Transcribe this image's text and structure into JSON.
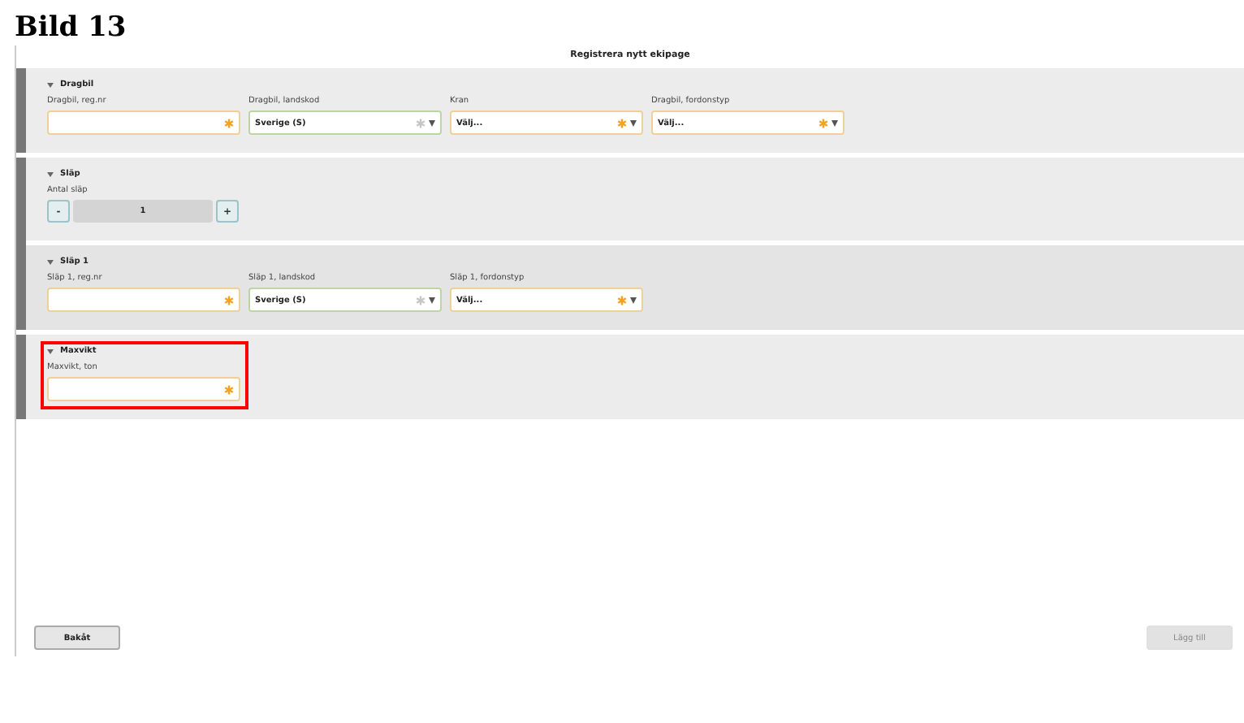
{
  "heading": "Bild 13",
  "window": {
    "title": "Registrera nytt ekipage"
  },
  "sections": [
    {
      "title": "Dragbil",
      "expanded": true,
      "highlighted": false,
      "fields": [
        {
          "kind": "text",
          "label": "Dragbil, reg.nr",
          "valid": false
        },
        {
          "kind": "select",
          "label": "Dragbil, landskod",
          "value": "Sverige (S)",
          "valid": true
        },
        {
          "kind": "select",
          "label": "Kran",
          "value": "Välj...",
          "valid": false
        },
        {
          "kind": "select",
          "label": "Dragbil, fordonstyp",
          "value": "Välj...",
          "valid": false
        }
      ]
    },
    {
      "title": "Släp",
      "expanded": true,
      "highlighted": false,
      "stepper": {
        "label": "Antal släp",
        "minus": "-",
        "value": "1",
        "plus": "+"
      },
      "children": [
        {
          "title": "Släp 1",
          "expanded": true,
          "highlighted": false,
          "fields": [
            {
              "kind": "text",
              "label": "Släp 1, reg.nr",
              "valid": false
            },
            {
              "kind": "select",
              "label": "Släp 1, landskod",
              "value": "Sverige (S)",
              "valid": true
            },
            {
              "kind": "select",
              "label": "Släp 1, fordonstyp",
              "value": "Välj...",
              "valid": false
            }
          ]
        }
      ]
    },
    {
      "title": "Maxvikt",
      "expanded": true,
      "highlighted": true,
      "fields": [
        {
          "kind": "text",
          "label": "Maxvikt, ton",
          "valid": false
        }
      ]
    }
  ],
  "buttons": [
    {
      "label": "Bakåt",
      "disabled": false
    },
    {
      "label": "Lägg till",
      "disabled": true
    }
  ]
}
